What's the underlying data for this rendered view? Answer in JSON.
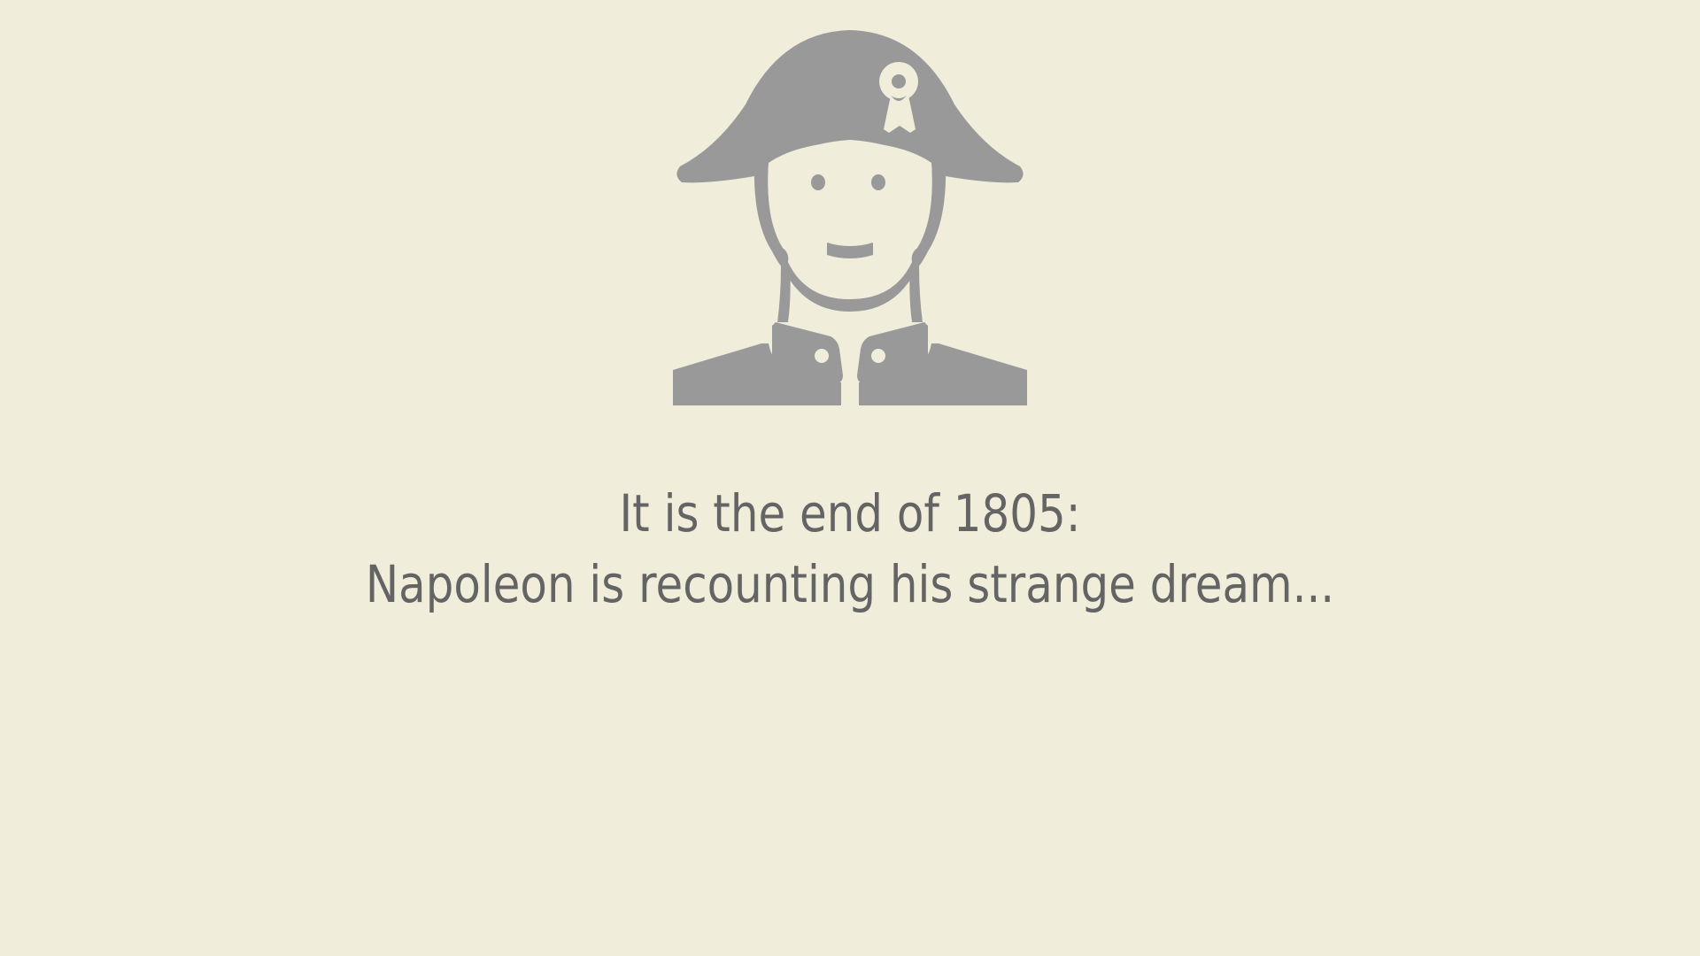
{
  "scene": {
    "portrait_icon": "napoleon-bicorne-portrait-icon",
    "lines": [
      "It is the end of 1805:",
      "Napoleon is recounting his strange dream..."
    ]
  },
  "colors": {
    "background": "#f0eddb",
    "icon": "#999999",
    "text": "#646464"
  }
}
